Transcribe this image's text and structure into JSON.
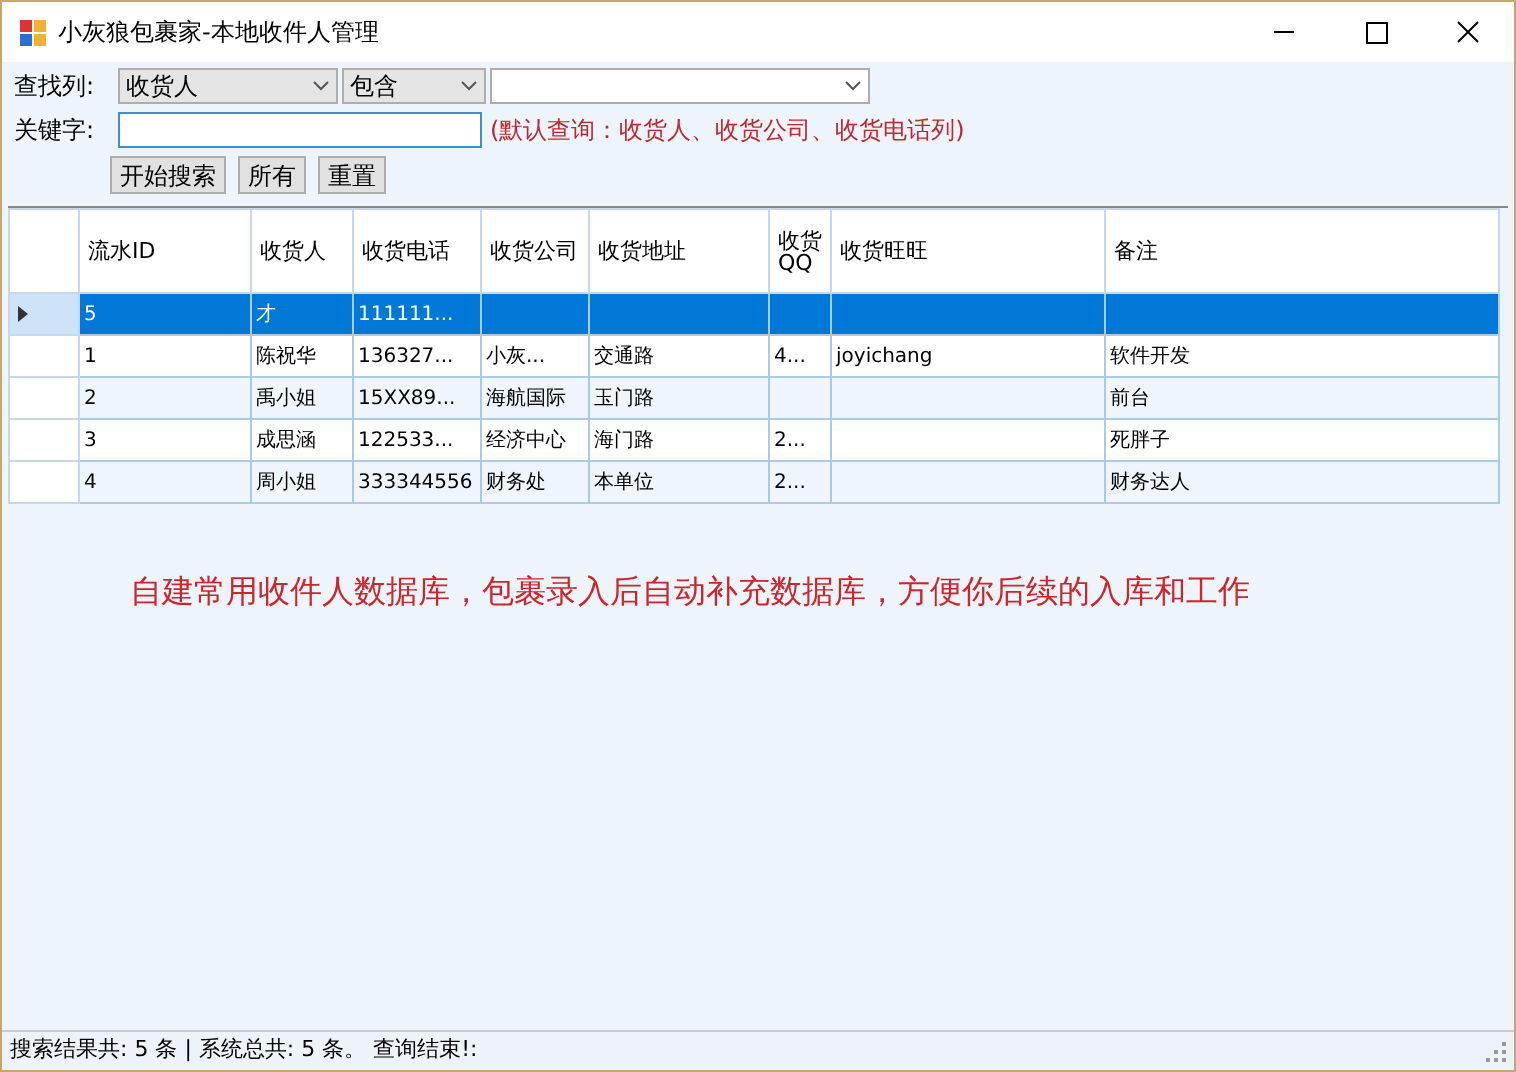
{
  "window": {
    "title": "小灰狼包裹家-本地收件人管理"
  },
  "search": {
    "column_label": "查找列:",
    "column_value": "收货人",
    "operator_value": "包含",
    "keyword_label": "关键字:",
    "hint": "(默认查询：收货人、收货公司、收货电话列)",
    "buttons": [
      "开始搜索",
      "所有",
      "重置"
    ]
  },
  "table": {
    "columns": [
      "流水ID",
      "收货人",
      "收货电话",
      "收货公司",
      "收货地址",
      "收货QQ",
      "收货旺旺",
      "备注"
    ],
    "rows": [
      {
        "selected": true,
        "cells": [
          "5",
          "才",
          "111111...",
          "",
          "",
          "",
          "",
          ""
        ]
      },
      {
        "selected": false,
        "cells": [
          "1",
          "陈祝华",
          "136327...",
          "小灰...",
          "交通路",
          "4...",
          "joyichang",
          "软件开发"
        ]
      },
      {
        "selected": false,
        "cells": [
          "2",
          "禹小姐",
          "15XX89...",
          "海航国际",
          "玉门路",
          "",
          "",
          "前台"
        ]
      },
      {
        "selected": false,
        "cells": [
          "3",
          "成思涵",
          "122533...",
          "经济中心",
          "海门路",
          "2...",
          "",
          "死胖子"
        ]
      },
      {
        "selected": false,
        "cells": [
          "4",
          "周小姐",
          "333344556",
          "财务处",
          "本单位",
          "2...",
          "",
          "财务达人"
        ]
      }
    ]
  },
  "note": "自建常用收件人数据库，包裹录入后自动补充数据库，方便你后续的入库和工作",
  "status_bar": "搜索结果共: 5 条 | 系统总共: 5 条。 查询结束!:"
}
